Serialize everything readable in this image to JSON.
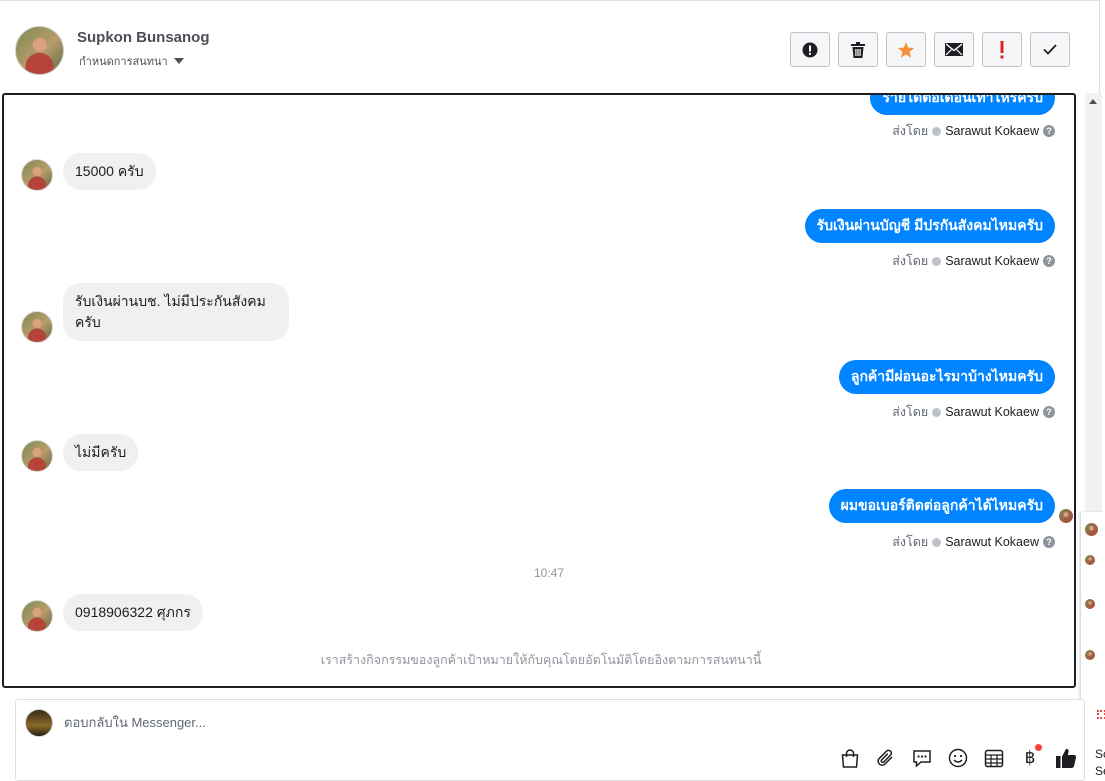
{
  "header": {
    "contact_name": "Supkon Bunsanog",
    "contact_sub": "กำหนดการสนทนา",
    "toolbar": [
      {
        "name": "spam-button",
        "icon": "exclamation-circle-icon"
      },
      {
        "name": "delete-button",
        "icon": "trash-icon"
      },
      {
        "name": "star-button",
        "icon": "star-icon"
      },
      {
        "name": "mark-unread-button",
        "icon": "envelope-icon"
      },
      {
        "name": "follow-up-button",
        "icon": "red-exclamation-icon"
      },
      {
        "name": "done-button",
        "icon": "checkmark-icon"
      }
    ]
  },
  "thread": {
    "partial_top_message": "รายได้ต่อเดือนเท่าไหร่ครับ",
    "sent_by_label": "ส่งโดย",
    "sender_name": "Sarawut Kokaew",
    "messages": [
      {
        "dir": "in",
        "text": "15000 ครับ"
      },
      {
        "dir": "out",
        "text": "รับเงินผ่านบัญชี มีปรกันสังคมไหมครับ"
      },
      {
        "dir": "in",
        "text": "รับเงินผ่านบช. ไม่มีประกันสังคม ครับ"
      },
      {
        "dir": "out",
        "text": "ลูกค้ามีผ่อนอะไรมาบ้างไหมครับ"
      },
      {
        "dir": "in",
        "text": "ไม่มีครับ"
      },
      {
        "dir": "out",
        "text": "ผมขอเบอร์ติดต่อลูกค้าได้ไหมครับ"
      },
      {
        "dir": "in",
        "text": "0918906322 ศุภกร"
      }
    ],
    "timestamp": "10:47",
    "notice": "เราสร้างกิจกรรมของลูกค้าเป้าหมายให้กับคุณโดยอัตโนมัติโดยอิงตามการสนทนานี้"
  },
  "composer": {
    "placeholder": "ตอบกลับใน Messenger...",
    "tools": [
      "shopping-bag-icon",
      "paperclip-icon",
      "saved-reply-icon",
      "emoji-icon",
      "appointment-icon",
      "baht-payment-icon",
      "like-icon"
    ],
    "baht_symbol": "฿"
  },
  "side_panel": {
    "texts": [
      "Sc",
      "Se"
    ]
  }
}
